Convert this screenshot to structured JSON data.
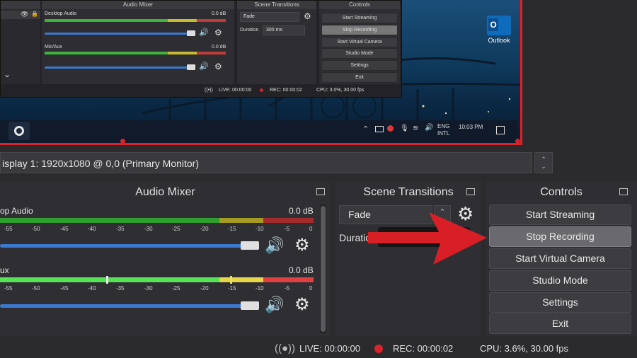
{
  "nested": {
    "audio_mixer_title": "Audio Mixer",
    "scene_transitions_title": "Scene Transitions",
    "controls_title": "Controls",
    "desktop_audio_label": "Desktop Audio",
    "desktop_audio_db": "0.0 dB",
    "mic_label": "Mic/Aux",
    "mic_db": "0.0 dB",
    "transition_value": "Fade",
    "duration_label": "Duration",
    "duration_value": "300 ms",
    "buttons": [
      "Start Streaming",
      "Stop Recording",
      "Start Virtual Camera",
      "Studio Mode",
      "Settings",
      "Exit"
    ],
    "live": "LIVE: 00:00:00",
    "rec": "REC: 00:00:02",
    "cpu": "CPU: 3.0%, 30.00 fps"
  },
  "desktop": {
    "outlook_label": "Outlook",
    "lang_top": "ENG",
    "lang_bottom": "INTL",
    "clock": "10:03 PM"
  },
  "source": {
    "display_text": "isplay 1: 1920x1080 @ 0,0 (Primary Monitor)"
  },
  "audio_mixer": {
    "title": "Audio Mixer",
    "channels": [
      {
        "label": "op Audio",
        "db": "0.0 dB",
        "level": 0.72
      },
      {
        "label": "ux",
        "db": "0.0 dB",
        "level": 0.62
      }
    ],
    "ticks": [
      "-55",
      "-50",
      "-45",
      "-40",
      "-35",
      "-30",
      "-25",
      "-20",
      "-15",
      "-10",
      "-5",
      "0"
    ],
    "volume": 0.96
  },
  "scene_transitions": {
    "title": "Scene Transitions",
    "transition": "Fade",
    "duration_label": "Duratio"
  },
  "controls": {
    "title": "Controls",
    "start_streaming": "Start Streaming",
    "stop_recording": "Stop Recording",
    "start_virtual_camera": "Start Virtual Camera",
    "studio_mode": "Studio Mode",
    "settings": "Settings",
    "exit": "Exit"
  },
  "status": {
    "live": "LIVE: 00:00:00",
    "rec": "REC: 00:00:02",
    "cpu": "CPU: 3.6%, 30.00 fps"
  },
  "colors": {
    "accent_blue": "#3b78d0",
    "record_red": "#d8232a",
    "annotation_arrow": "#d81f26"
  }
}
